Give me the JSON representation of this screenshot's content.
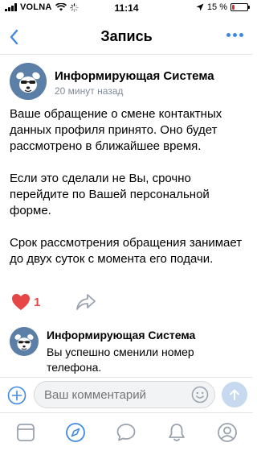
{
  "status_bar": {
    "carrier": "VOLNA",
    "time": "11:14",
    "battery_label": "15 %",
    "battery_level": 0.15,
    "battery_color": "#e0302a"
  },
  "nav": {
    "title": "Запись",
    "back_icon": "chevron-left-icon",
    "more_icon": "more-horizontal-icon"
  },
  "post": {
    "author": "Информирующая Система",
    "time": "20 минут назад",
    "paragraphs": [
      "Ваше обращение о смене контактных данных профиля принято. Оно будет рассмотрено в ближайшее время.",
      "Если это сделали не Вы, срочно перейдите по Вашей персональной форме.",
      "Срок рассмотрения обращения занимает до двух суток с момента его подачи."
    ],
    "likes": "1",
    "like_icon": "heart-icon",
    "share_icon": "share-icon"
  },
  "comment": {
    "author": "Информирующая Система",
    "text_line1": "Вы успешно сменили номер",
    "text_line2": "телефона."
  },
  "composer": {
    "placeholder": "Ваш комментарий",
    "add_icon": "plus-circle-icon",
    "emoji_icon": "emoji-icon",
    "send_icon": "send-arrow-icon"
  },
  "tabs": [
    {
      "icon": "news-icon"
    },
    {
      "icon": "discover-compass-icon"
    },
    {
      "icon": "messages-icon"
    },
    {
      "icon": "notifications-bell-icon"
    },
    {
      "icon": "profile-icon"
    }
  ],
  "colors": {
    "accent": "#3f8ae0",
    "like": "#e64646",
    "secondary_text": "#818c99"
  }
}
